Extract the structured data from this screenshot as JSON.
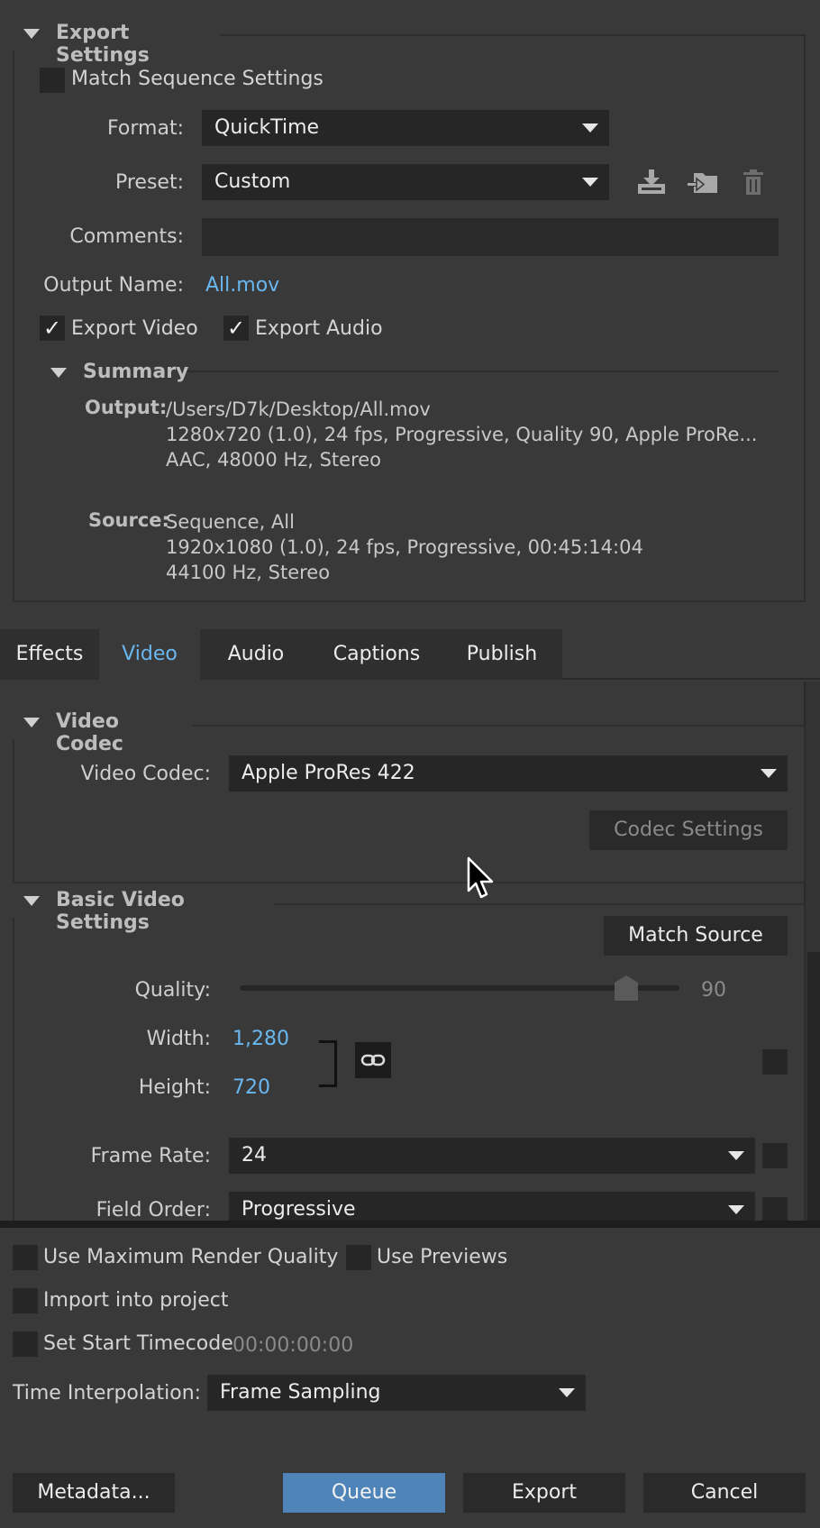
{
  "export_settings": {
    "title": "Export Settings",
    "match_sequence": "Match Sequence Settings",
    "format_label": "Format:",
    "format_value": "QuickTime",
    "preset_label": "Preset:",
    "preset_value": "Custom",
    "comments_label": "Comments:",
    "comments_value": "",
    "output_name_label": "Output Name:",
    "output_name_value": "All.mov",
    "export_video": "Export Video",
    "export_audio": "Export Audio",
    "icons": [
      "save-preset-icon",
      "import-preset-icon",
      "delete-preset-icon"
    ]
  },
  "summary": {
    "title": "Summary",
    "output_label": "Output:",
    "output_lines": [
      "/Users/D7k/Desktop/All.mov",
      "1280x720 (1.0), 24 fps, Progressive, Quality 90, Apple ProRe...",
      "AAC, 48000 Hz, Stereo"
    ],
    "source_label": "Source:",
    "source_lines": [
      "Sequence, All",
      "1920x1080 (1.0), 24 fps, Progressive, 00:45:14:04",
      "44100 Hz, Stereo"
    ]
  },
  "tabs": [
    {
      "label": "Effects",
      "active": false
    },
    {
      "label": "Video",
      "active": true
    },
    {
      "label": "Audio",
      "active": false
    },
    {
      "label": "Captions",
      "active": false
    },
    {
      "label": "Publish",
      "active": false
    }
  ],
  "video_codec": {
    "title": "Video Codec",
    "label": "Video Codec:",
    "value": "Apple ProRes 422",
    "codec_settings": "Codec Settings"
  },
  "basic_video": {
    "title": "Basic Video Settings",
    "match_source": "Match Source",
    "quality_label": "Quality:",
    "quality_value": "90",
    "quality_fraction": 0.9,
    "width_label": "Width:",
    "width_value": "1,280",
    "height_label": "Height:",
    "height_value": "720",
    "frame_rate_label": "Frame Rate:",
    "frame_rate_value": "24",
    "field_order_label": "Field Order:",
    "field_order_value": "Progressive"
  },
  "bottom": {
    "max_render": "Use Maximum Render Quality",
    "use_previews": "Use Previews",
    "import_project": "Import into project",
    "set_start_tc": "Set Start Timecode",
    "start_tc_value": "00:00:00:00",
    "time_interp_label": "Time Interpolation:",
    "time_interp_value": "Frame Sampling"
  },
  "buttons": {
    "metadata": "Metadata...",
    "queue": "Queue",
    "export": "Export",
    "cancel": "Cancel"
  },
  "colors": {
    "accent": "#69b7f0",
    "queue_button": "#4f84b9",
    "background": "#393939"
  }
}
